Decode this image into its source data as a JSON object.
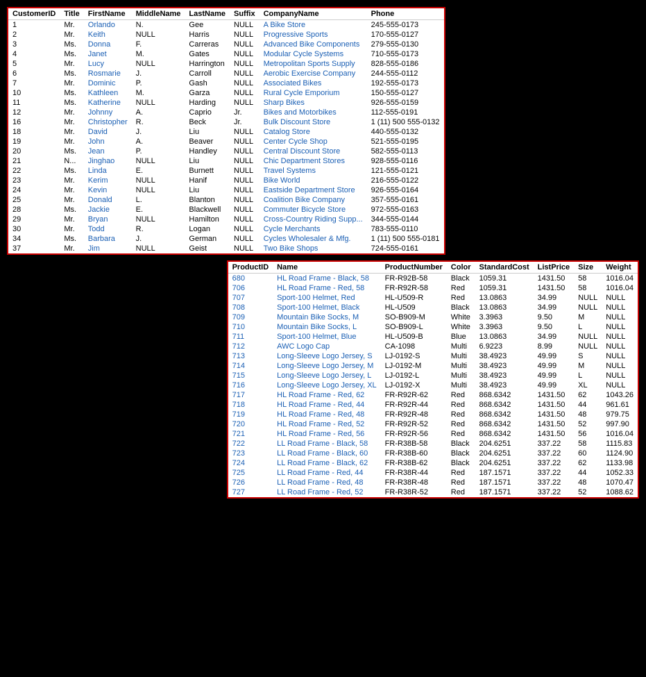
{
  "topTable": {
    "columns": [
      "CustomerID",
      "Title",
      "FirstName",
      "MiddleName",
      "LastName",
      "Suffix",
      "CompanyName",
      "Phone"
    ],
    "rows": [
      [
        "1",
        "Mr.",
        "Orlando",
        "N.",
        "Gee",
        "NULL",
        "A Bike Store",
        "245-555-0173"
      ],
      [
        "2",
        "Mr.",
        "Keith",
        "NULL",
        "Harris",
        "NULL",
        "Progressive Sports",
        "170-555-0127"
      ],
      [
        "3",
        "Ms.",
        "Donna",
        "F.",
        "Carreras",
        "NULL",
        "Advanced Bike Components",
        "279-555-0130"
      ],
      [
        "4",
        "Ms.",
        "Janet",
        "M.",
        "Gates",
        "NULL",
        "Modular Cycle Systems",
        "710-555-0173"
      ],
      [
        "5",
        "Mr.",
        "Lucy",
        "NULL",
        "Harrington",
        "NULL",
        "Metropolitan Sports Supply",
        "828-555-0186"
      ],
      [
        "6",
        "Ms.",
        "Rosmarie",
        "J.",
        "Carroll",
        "NULL",
        "Aerobic Exercise Company",
        "244-555-0112"
      ],
      [
        "7",
        "Mr.",
        "Dominic",
        "P.",
        "Gash",
        "NULL",
        "Associated Bikes",
        "192-555-0173"
      ],
      [
        "10",
        "Ms.",
        "Kathleen",
        "M.",
        "Garza",
        "NULL",
        "Rural Cycle Emporium",
        "150-555-0127"
      ],
      [
        "11",
        "Ms.",
        "Katherine",
        "NULL",
        "Harding",
        "NULL",
        "Sharp Bikes",
        "926-555-0159"
      ],
      [
        "12",
        "Mr.",
        "Johnny",
        "A.",
        "Caprio",
        "Jr.",
        "Bikes and Motorbikes",
        "112-555-0191"
      ],
      [
        "16",
        "Mr.",
        "Christopher",
        "R.",
        "Beck",
        "Jr.",
        "Bulk Discount Store",
        "1 (11) 500 555-0132"
      ],
      [
        "18",
        "Mr.",
        "David",
        "J.",
        "Liu",
        "NULL",
        "Catalog Store",
        "440-555-0132"
      ],
      [
        "19",
        "Mr.",
        "John",
        "A.",
        "Beaver",
        "NULL",
        "Center Cycle Shop",
        "521-555-0195"
      ],
      [
        "20",
        "Ms.",
        "Jean",
        "P.",
        "Handley",
        "NULL",
        "Central Discount Store",
        "582-555-0113"
      ],
      [
        "21",
        "N...",
        "Jinghao",
        "NULL",
        "Liu",
        "NULL",
        "Chic Department Stores",
        "928-555-0116"
      ],
      [
        "22",
        "Ms.",
        "Linda",
        "E.",
        "Burnett",
        "NULL",
        "Travel Systems",
        "121-555-0121"
      ],
      [
        "23",
        "Mr.",
        "Kerim",
        "NULL",
        "Hanif",
        "NULL",
        "Bike World",
        "216-555-0122"
      ],
      [
        "24",
        "Mr.",
        "Kevin",
        "NULL",
        "Liu",
        "NULL",
        "Eastside Department Store",
        "926-555-0164"
      ],
      [
        "25",
        "Mr.",
        "Donald",
        "L.",
        "Blanton",
        "NULL",
        "Coalition Bike Company",
        "357-555-0161"
      ],
      [
        "28",
        "Ms.",
        "Jackie",
        "E.",
        "Blackwell",
        "NULL",
        "Commuter Bicycle Store",
        "972-555-0163"
      ],
      [
        "29",
        "Mr.",
        "Bryan",
        "NULL",
        "Hamilton",
        "NULL",
        "Cross-Country Riding Supp...",
        "344-555-0144"
      ],
      [
        "30",
        "Mr.",
        "Todd",
        "R.",
        "Logan",
        "NULL",
        "Cycle Merchants",
        "783-555-0110"
      ],
      [
        "34",
        "Ms.",
        "Barbara",
        "J.",
        "German",
        "NULL",
        "Cycles Wholesaler & Mfg.",
        "1 (11) 500 555-0181"
      ],
      [
        "37",
        "Mr.",
        "Jim",
        "NULL",
        "Geist",
        "NULL",
        "Two Bike Shops",
        "724-555-0161"
      ]
    ]
  },
  "bottomTable": {
    "columns": [
      "ProductID",
      "Name",
      "ProductNumber",
      "Color",
      "StandardCost",
      "ListPrice",
      "Size",
      "Weight"
    ],
    "rows": [
      [
        "680",
        "HL Road Frame - Black, 58",
        "FR-R92B-58",
        "Black",
        "1059.31",
        "1431.50",
        "58",
        "1016.04"
      ],
      [
        "706",
        "HL Road Frame - Red, 58",
        "FR-R92R-58",
        "Red",
        "1059.31",
        "1431.50",
        "58",
        "1016.04"
      ],
      [
        "707",
        "Sport-100 Helmet, Red",
        "HL-U509-R",
        "Red",
        "13.0863",
        "34.99",
        "NULL",
        "NULL"
      ],
      [
        "708",
        "Sport-100 Helmet, Black",
        "HL-U509",
        "Black",
        "13.0863",
        "34.99",
        "NULL",
        "NULL"
      ],
      [
        "709",
        "Mountain Bike Socks, M",
        "SO-B909-M",
        "White",
        "3.3963",
        "9.50",
        "M",
        "NULL"
      ],
      [
        "710",
        "Mountain Bike Socks, L",
        "SO-B909-L",
        "White",
        "3.3963",
        "9.50",
        "L",
        "NULL"
      ],
      [
        "711",
        "Sport-100 Helmet, Blue",
        "HL-U509-B",
        "Blue",
        "13.0863",
        "34.99",
        "NULL",
        "NULL"
      ],
      [
        "712",
        "AWC Logo Cap",
        "CA-1098",
        "Multi",
        "6.9223",
        "8.99",
        "NULL",
        "NULL"
      ],
      [
        "713",
        "Long-Sleeve Logo Jersey, S",
        "LJ-0192-S",
        "Multi",
        "38.4923",
        "49.99",
        "S",
        "NULL"
      ],
      [
        "714",
        "Long-Sleeve Logo Jersey, M",
        "LJ-0192-M",
        "Multi",
        "38.4923",
        "49.99",
        "M",
        "NULL"
      ],
      [
        "715",
        "Long-Sleeve Logo Jersey, L",
        "LJ-0192-L",
        "Multi",
        "38.4923",
        "49.99",
        "L",
        "NULL"
      ],
      [
        "716",
        "Long-Sleeve Logo Jersey, XL",
        "LJ-0192-X",
        "Multi",
        "38.4923",
        "49.99",
        "XL",
        "NULL"
      ],
      [
        "717",
        "HL Road Frame - Red, 62",
        "FR-R92R-62",
        "Red",
        "868.6342",
        "1431.50",
        "62",
        "1043.26"
      ],
      [
        "718",
        "HL Road Frame - Red, 44",
        "FR-R92R-44",
        "Red",
        "868.6342",
        "1431.50",
        "44",
        "961.61"
      ],
      [
        "719",
        "HL Road Frame - Red, 48",
        "FR-R92R-48",
        "Red",
        "868.6342",
        "1431.50",
        "48",
        "979.75"
      ],
      [
        "720",
        "HL Road Frame - Red, 52",
        "FR-R92R-52",
        "Red",
        "868.6342",
        "1431.50",
        "52",
        "997.90"
      ],
      [
        "721",
        "HL Road Frame - Red, 56",
        "FR-R92R-56",
        "Red",
        "868.6342",
        "1431.50",
        "56",
        "1016.04"
      ],
      [
        "722",
        "LL Road Frame - Black, 58",
        "FR-R38B-58",
        "Black",
        "204.6251",
        "337.22",
        "58",
        "1115.83"
      ],
      [
        "723",
        "LL Road Frame - Black, 60",
        "FR-R38B-60",
        "Black",
        "204.6251",
        "337.22",
        "60",
        "1124.90"
      ],
      [
        "724",
        "LL Road Frame - Black, 62",
        "FR-R38B-62",
        "Black",
        "204.6251",
        "337.22",
        "62",
        "1133.98"
      ],
      [
        "725",
        "LL Road Frame - Red, 44",
        "FR-R38R-44",
        "Red",
        "187.1571",
        "337.22",
        "44",
        "1052.33"
      ],
      [
        "726",
        "LL Road Frame - Red, 48",
        "FR-R38R-48",
        "Red",
        "187.1571",
        "337.22",
        "48",
        "1070.47"
      ],
      [
        "727",
        "LL Road Frame - Red, 52",
        "FR-R38R-52",
        "Red",
        "187.1571",
        "337.22",
        "52",
        "1088.62"
      ]
    ]
  }
}
